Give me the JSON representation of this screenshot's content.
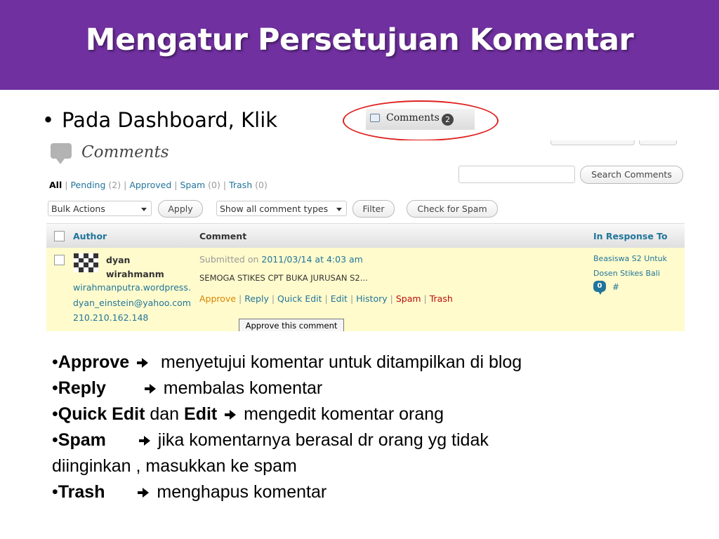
{
  "slide": {
    "title": "Mengatur Persetujuan Komentar",
    "bullet_dot": "•",
    "bullet_text": "Pada Dashboard, Klik",
    "accent_color": "#7030a0"
  },
  "menu": {
    "label": "Comments",
    "count": "2"
  },
  "wp": {
    "heading": "Comments",
    "filters": [
      {
        "label": "All",
        "count": ""
      },
      {
        "label": "Pending",
        "count": "(2)"
      },
      {
        "label": "Approved",
        "count": ""
      },
      {
        "label": "Spam",
        "count": "(0)"
      },
      {
        "label": "Trash",
        "count": "(0)"
      }
    ],
    "separator": "|",
    "search_button": "Search Comments",
    "search_value": "",
    "bulk_actions": "Bulk Actions",
    "apply": "Apply",
    "comment_types": "Show all comment types",
    "filter": "Filter",
    "check_spam": "Check for Spam",
    "columns": {
      "author": "Author",
      "comment": "Comment",
      "response": "In Response To"
    },
    "row": {
      "author_name_1": "dyan",
      "author_name_2": "wirahmanm",
      "site": "wirahmanputra.wordpress.",
      "email": "dyan_einstein@yahoo.com",
      "ip": "210.210.162.148",
      "submitted_prefix": "Submitted on",
      "submitted_date": "2011/03/14 at 4:03 am",
      "text": "SEMOGA STIKES CPT BUKA JURUSAN S2...",
      "actions": {
        "approve": "Approve",
        "reply": "Reply",
        "quick_edit": "Quick Edit",
        "edit": "Edit",
        "history": "History",
        "spam": "Spam",
        "trash": "Trash"
      },
      "response_1": "Beasiswa S2 Untuk",
      "response_2": "Dosen Stikes Bali",
      "response_count": "0",
      "response_hash": "#"
    },
    "tooltip": "Approve this comment"
  },
  "notes": {
    "bullet": "•",
    "approve_term": "Approve",
    "approve_desc": "menyetujui komentar untuk ditampilkan di blog",
    "reply_term": "Reply",
    "reply_desc": "membalas komentar",
    "quickedit_term": "Quick Edit",
    "and_word": "dan",
    "edit_term": "Edit",
    "edit_desc": "mengedit komentar orang",
    "spam_term": "Spam",
    "spam_desc_1": "jika komentarnya berasal dr orang yg tidak",
    "spam_desc_2": "diinginkan , masukkan ke spam",
    "trash_term": "Trash",
    "trash_desc": "menghapus komentar"
  }
}
